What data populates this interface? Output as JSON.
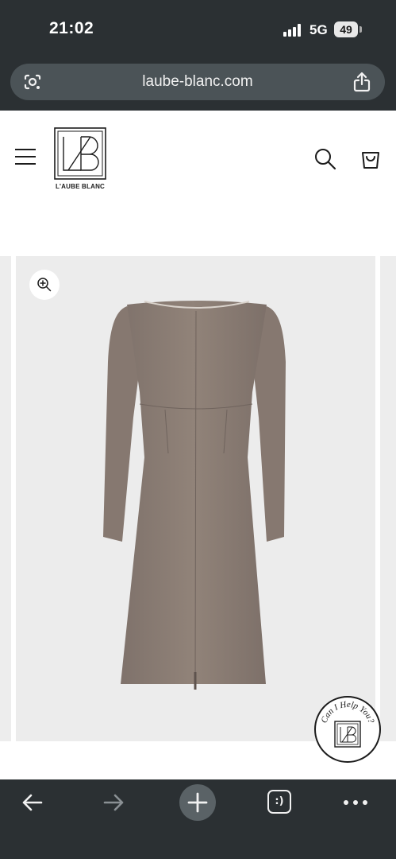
{
  "status_bar": {
    "time": "21:02",
    "network": "5G",
    "battery": "49",
    "icons": [
      "signal-icon",
      "battery-icon"
    ]
  },
  "browser": {
    "url": "laube-blanc.com",
    "icons": [
      "google-lens-icon",
      "share-icon"
    ]
  },
  "site_header": {
    "brand": "L'AUBE BLANC",
    "icons": [
      "menu-icon",
      "logo-monogram",
      "search-icon",
      "shopping-bag-icon"
    ]
  },
  "gallery": {
    "product": "long-sleeve boat-neck midi dress",
    "product_color": "#8f8179",
    "background_color": "#ececec",
    "icons": [
      "zoom-in-icon"
    ]
  },
  "help_badge": {
    "text": "Can I Help You?",
    "icon": "logo-monogram"
  },
  "toolbar": {
    "tabs_label": ":)",
    "icons": [
      "back-arrow-icon",
      "forward-arrow-icon",
      "new-tab-plus-icon",
      "tabs-icon",
      "more-dots-icon"
    ]
  },
  "colors": {
    "browser_chrome": "#2b3033",
    "url_bar": "#4b5357",
    "text_dark": "#1c1c1c"
  }
}
